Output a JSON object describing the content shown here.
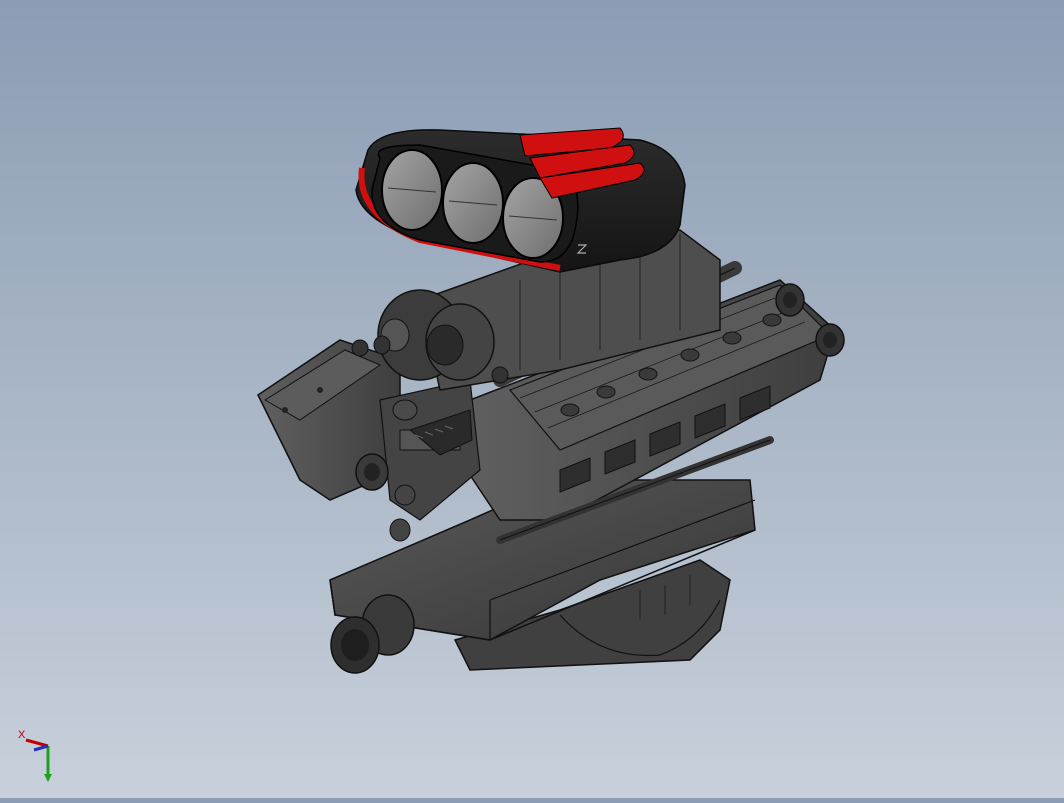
{
  "viewport": {
    "background_top": "#8b9cb4",
    "background_bottom": "#c8d0db",
    "model_colors": {
      "body": "#4a4a4a",
      "dark": "#2a2a2a",
      "edge": "#101010",
      "accent": "#d01010",
      "glass": "#8c8c8c"
    }
  },
  "triad": {
    "x_label": "X",
    "x_color": "#c00000",
    "y_color": "#1fa01f",
    "z_color": "#2030c0"
  }
}
